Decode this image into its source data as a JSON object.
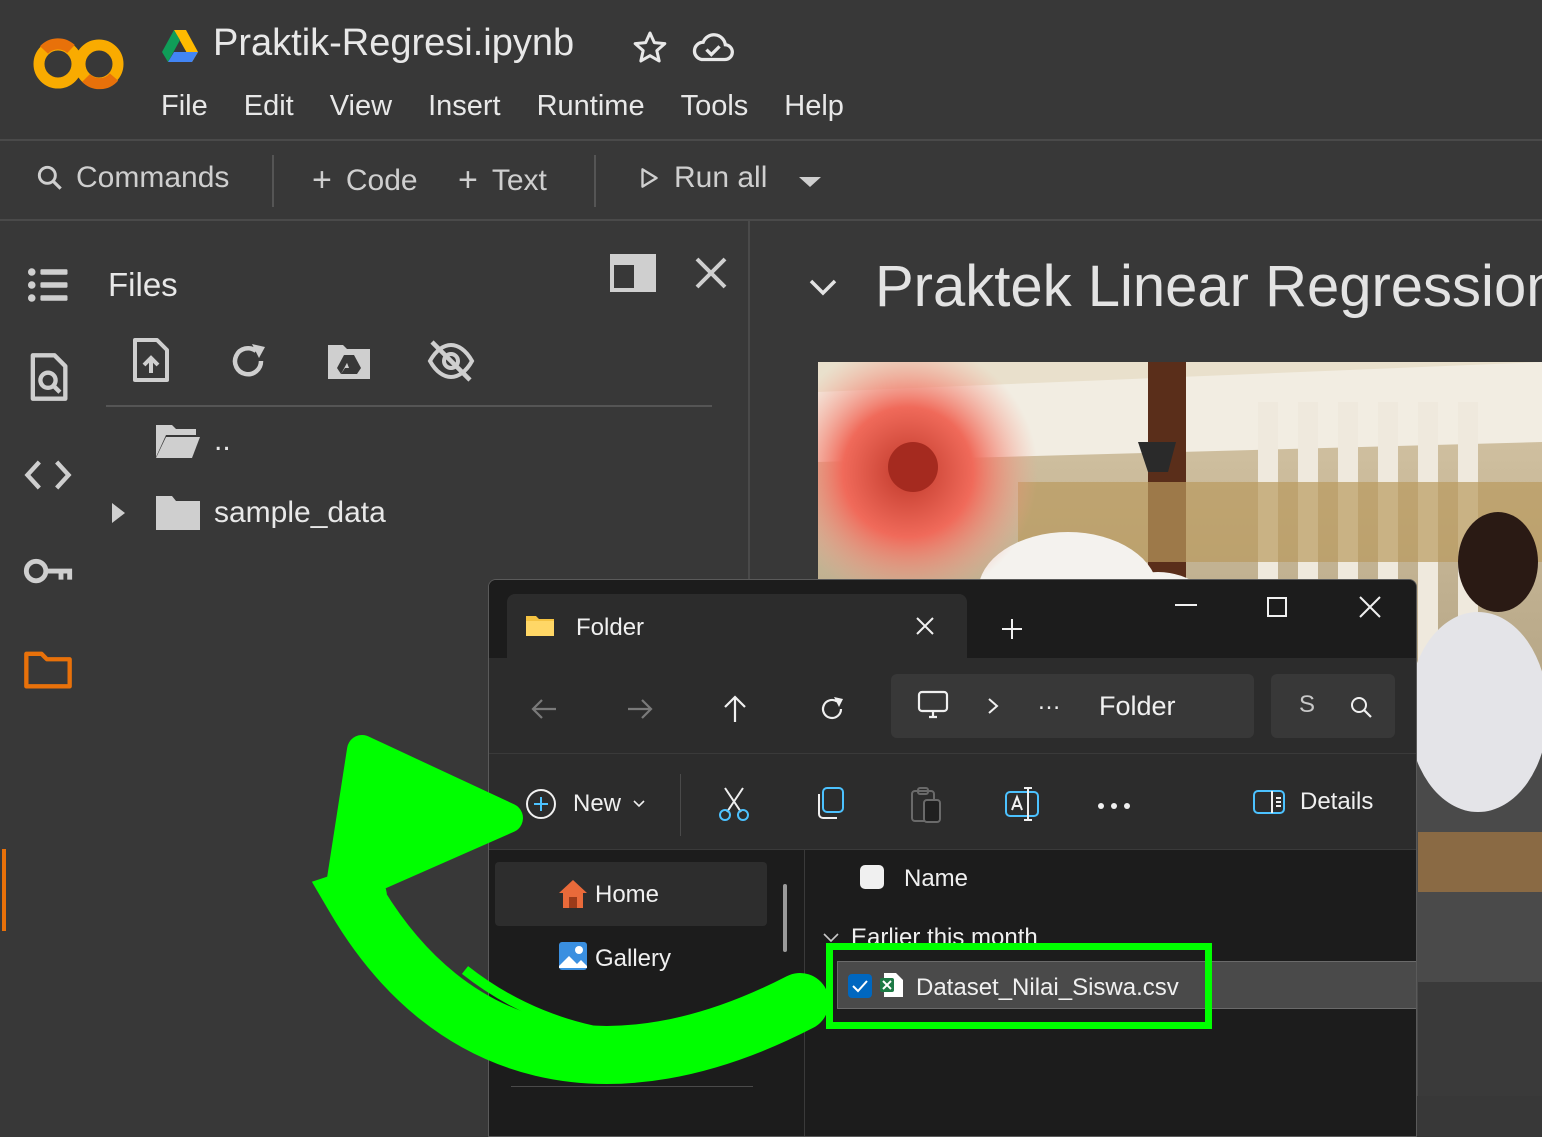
{
  "header": {
    "notebook_title": "Praktik-Regresi.ipynb",
    "menu": [
      "File",
      "Edit",
      "View",
      "Insert",
      "Runtime",
      "Tools",
      "Help"
    ]
  },
  "toolbar": {
    "commands_label": "Commands",
    "code_label": "Code",
    "text_label": "Text",
    "run_all_label": "Run all"
  },
  "files_panel": {
    "title": "Files",
    "parent_dir": "..",
    "items": [
      {
        "name": "sample_data",
        "type": "folder"
      }
    ]
  },
  "notebook": {
    "heading": "Praktek Linear Regression"
  },
  "explorer": {
    "tab_label": "Folder",
    "breadcrumb": "Folder",
    "breadcrumb_ellipsis": "…",
    "search_placeholder": "S",
    "new_label": "New",
    "details_label": "Details",
    "sidebar": [
      {
        "label": "Home",
        "selected": true
      },
      {
        "label": "Gallery",
        "selected": false
      }
    ],
    "column_name": "Name",
    "group_label": "Earlier this month",
    "files": [
      {
        "name": "Dataset_Nilai_Siswa.csv",
        "checked": true
      }
    ]
  },
  "colors": {
    "accent_orange": "#e8710a",
    "highlight_green": "#00ff00",
    "win_blue": "#0067c0"
  }
}
